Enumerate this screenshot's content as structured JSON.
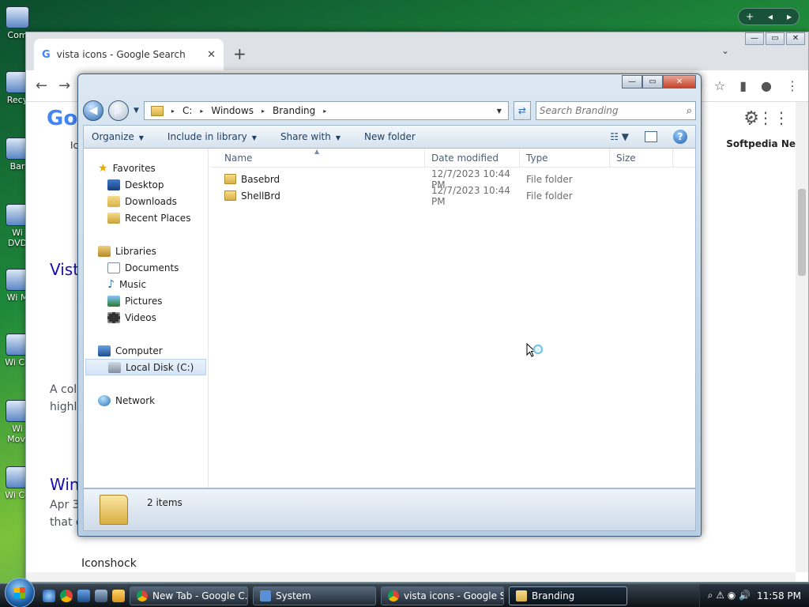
{
  "desktop": {
    "icons": [
      "Com",
      "Recy",
      "Bar",
      "Wi DVD",
      "Wi M",
      "Wi Ca",
      "Wi Movi",
      "Wi Co"
    ]
  },
  "gadget_bar": {
    "add": "+",
    "prev": "◂",
    "next": "▸"
  },
  "chrome": {
    "tab_title": "vista icons - Google Search",
    "tab_close": "✕",
    "new_tab": "+",
    "tab_menu": "⌄",
    "window_controls": {
      "minimize": "—",
      "maximize": "▭",
      "close": "✕"
    },
    "nav": {
      "back": "←",
      "forward": "→",
      "reload": "⟳"
    },
    "toolbar": {
      "star": "☆",
      "sidebar": "▮",
      "profile": "●",
      "menu": "⋮"
    },
    "page": {
      "logo": "Go",
      "settings": "⚙",
      "apps": "⋮⋮⋮",
      "softpedia": "Softpedia Ne",
      "results": [
        {
          "title": "Vista",
          "snippet_line1": "A colle",
          "snippet_line2": "highlig"
        },
        {
          "title": "Winc",
          "snippet_line1": "Apr 3",
          "snippet_line2": "that dis"
        }
      ],
      "iconshock": "Iconshock",
      "icons_label": "Ico"
    }
  },
  "explorer": {
    "window_controls": {
      "minimize": "—",
      "maximize": "▭",
      "close": "✕"
    },
    "nav": {
      "back": "◀",
      "forward": "▶",
      "dropdown": "▼"
    },
    "address": {
      "segments": [
        "C:",
        "Windows",
        "Branding"
      ],
      "chevron": "▸",
      "dropdown": "▼",
      "refresh": "⇄"
    },
    "search": {
      "placeholder": "Search Branding",
      "icon": "⌕"
    },
    "commands": {
      "organize": "Organize",
      "include_in_library": "Include in library",
      "share_with": "Share with",
      "new_folder": "New folder",
      "arrow": "▼",
      "views": "☷ ▼",
      "help": "?"
    },
    "navpane": {
      "favorites": "Favorites",
      "favorite_items": [
        "Desktop",
        "Downloads",
        "Recent Places"
      ],
      "libraries": "Libraries",
      "library_items": [
        "Documents",
        "Music",
        "Pictures",
        "Videos"
      ],
      "computer": "Computer",
      "computer_items": [
        "Local Disk (C:)"
      ],
      "network": "Network",
      "star": "★",
      "note": "♪"
    },
    "columns": {
      "name": "Name",
      "date": "Date modified",
      "type": "Type",
      "size": "Size",
      "sort": "▲"
    },
    "files": [
      {
        "name": "Basebrd",
        "date": "12/7/2023 10:44 PM",
        "type": "File folder",
        "size": ""
      },
      {
        "name": "ShellBrd",
        "date": "12/7/2023 10:44 PM",
        "type": "File folder",
        "size": ""
      }
    ],
    "details": {
      "count": "2 items"
    }
  },
  "taskbar": {
    "buttons": [
      {
        "label": "New Tab - Google C...",
        "color": "#e8b34b"
      },
      {
        "label": "System",
        "color": "#5a8fd6"
      },
      {
        "label": "vista icons - Google S...",
        "color": "#e8b34b"
      },
      {
        "label": "Branding",
        "color": "#e8c05a"
      }
    ],
    "tray": {
      "icons": "⌕ ⚠ ◉ 🔊",
      "clock": "11:58 PM"
    }
  }
}
